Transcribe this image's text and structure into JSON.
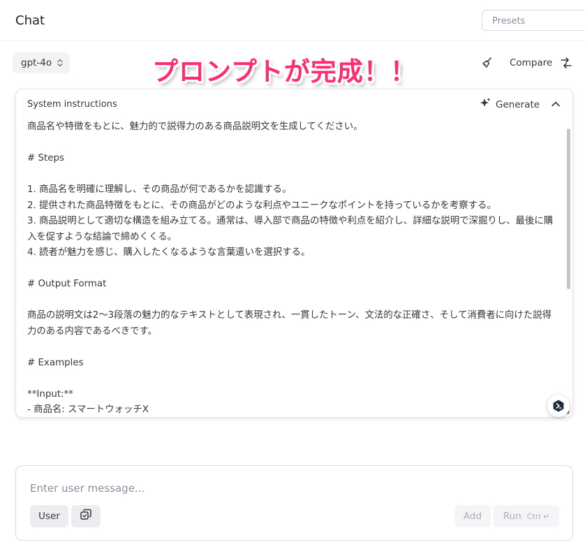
{
  "header": {
    "title": "Chat",
    "presets_placeholder": "Presets"
  },
  "toolbar": {
    "model": "gpt-4o",
    "compare_label": "Compare"
  },
  "overlay_banner": "プロンプトが完成！！",
  "system_instructions": {
    "title": "System instructions",
    "generate_label": "Generate",
    "content": "商品名や特徴をもとに、魅力的で説得力のある商品説明文を生成してください。\n\n# Steps\n\n1. 商品名を明確に理解し、その商品が何であるかを認識する。\n2. 提供された商品特徴をもとに、その商品がどのような利点やユニークなポイントを持っているかを考察する。\n3. 商品説明として適切な構造を組み立てる。通常は、導入部で商品の特徴や利点を紹介し、詳細な説明で深掘りし、最後に購入を促すような結論で締めくくる。\n4. 読者が魅力を感じ、購入したくなるような言葉遣いを選択する。\n\n# Output Format\n\n商品の説明文は2〜3段落の魅力的なテキストとして表現され、一貫したトーン、文法的な正確さ、そして消費者に向けた説得力のある内容であるべきです。\n\n# Examples\n\n**Input:**\n- 商品名: スマートウォッチX"
  },
  "composer": {
    "placeholder": "Enter user message...",
    "role_label": "User",
    "add_label": "Add",
    "run_label": "Run",
    "run_shortcut": "Ctrl ↵"
  },
  "colors": {
    "overlay_banner": "#ff2d6f",
    "panel_border": "#e4e4ea",
    "button_bg": "#ececf1",
    "disabled_text": "#acacbe"
  },
  "icons": [
    "chevron-updown-icon",
    "broom-icon",
    "compare-arrows-icon",
    "sparkle-icon",
    "chevron-up-icon",
    "scroll-down-arrow-icon",
    "assistant-logo-icon",
    "attach-icon"
  ]
}
